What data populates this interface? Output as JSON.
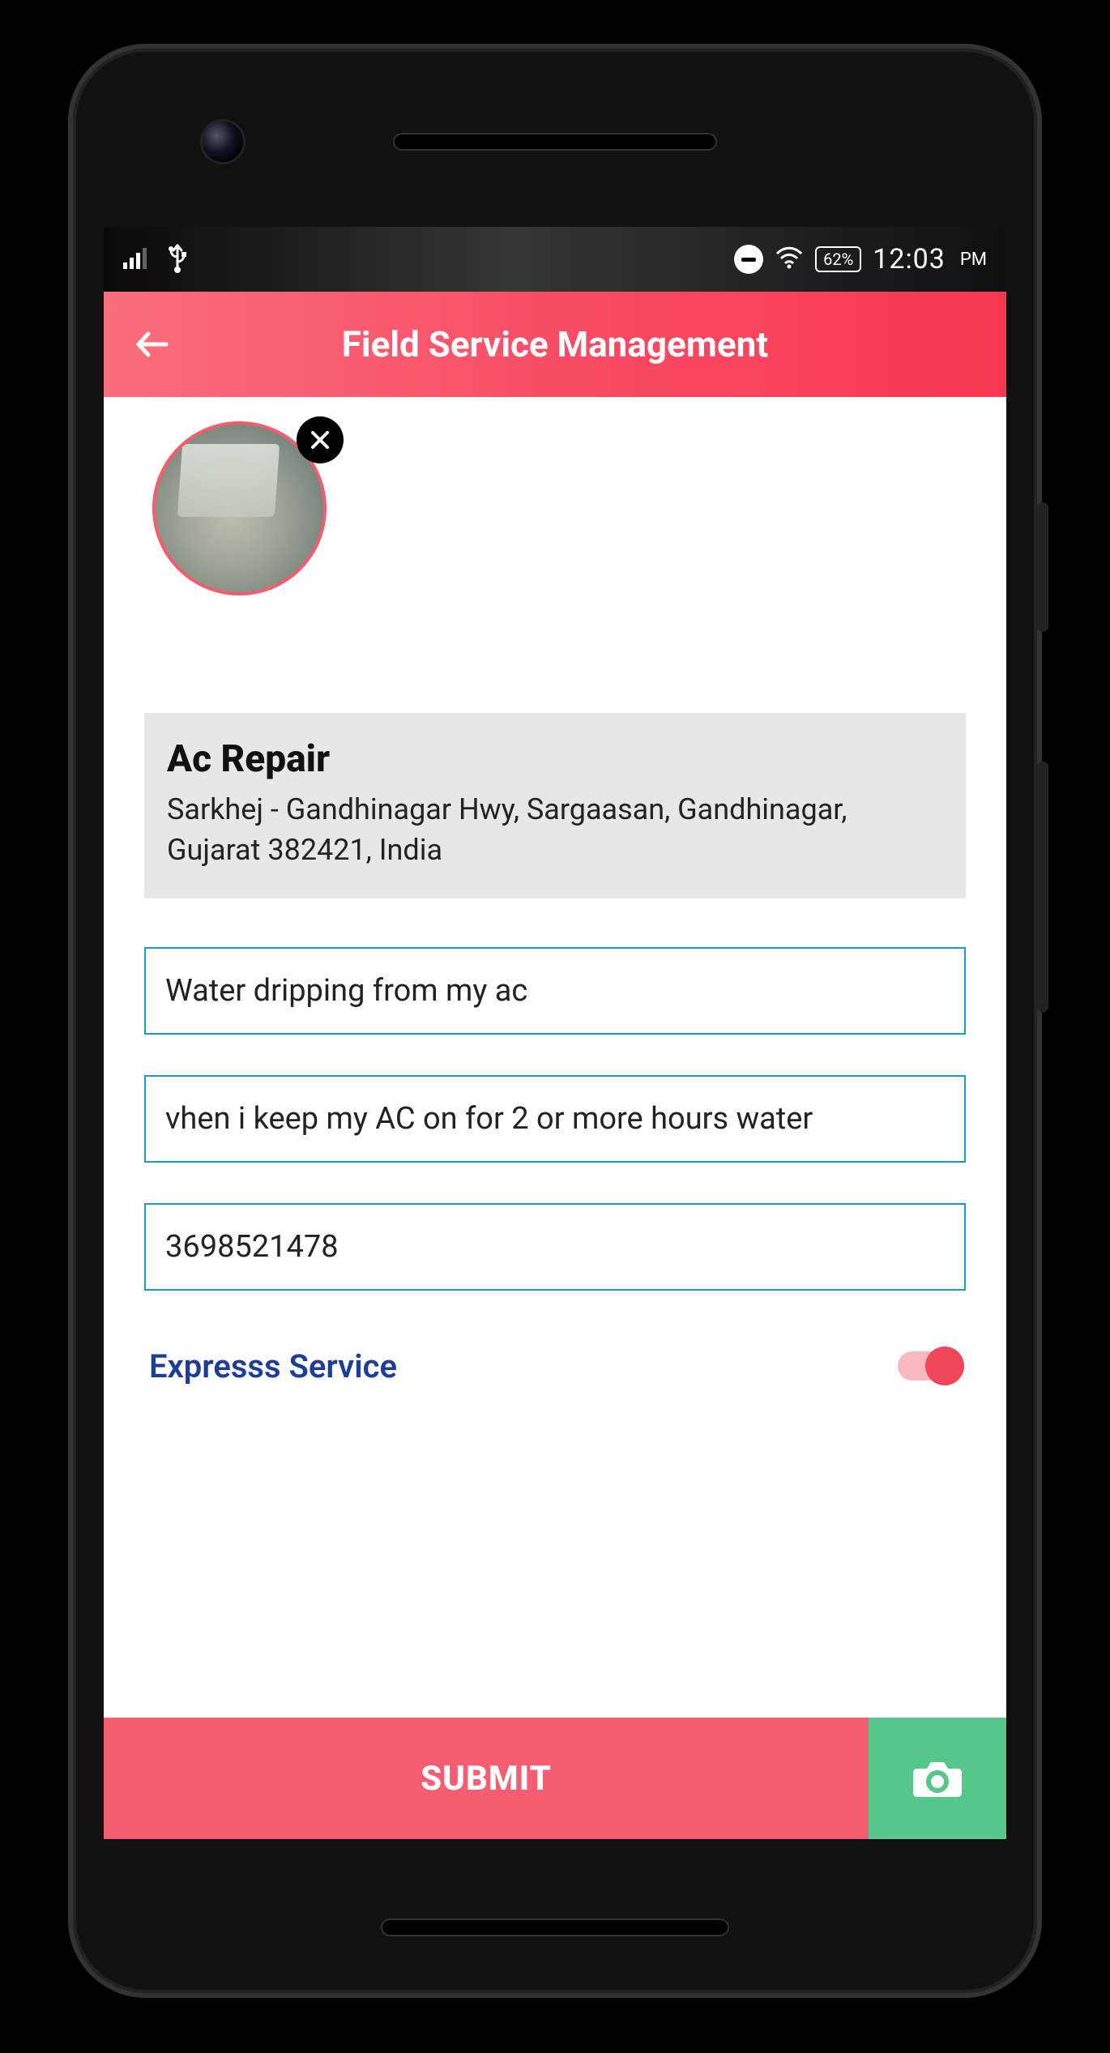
{
  "status_bar": {
    "battery_percent": "62%",
    "time": "12:03",
    "time_ampm": "PM"
  },
  "app_bar": {
    "title": "Field Service Management"
  },
  "service": {
    "title": "Ac Repair",
    "address": "Sarkhej - Gandhinagar Hwy, Sargaasan, Gandhinagar, Gujarat 382421, India"
  },
  "form": {
    "subject": "Water dripping from my ac",
    "description": "vhen i keep my AC on for 2 or more hours water",
    "phone": "3698521478",
    "express_label": "Expresss Service",
    "express_on": true
  },
  "actions": {
    "submit_label": "SUBMIT"
  },
  "icons": {
    "back": "arrow-back-icon",
    "remove_photo": "close-icon",
    "camera": "camera-icon",
    "signal": "signal-icon",
    "usb": "usb-icon",
    "dnd": "dnd-icon",
    "wifi": "wifi-icon",
    "battery": "battery-icon"
  },
  "colors": {
    "accent": "#f6384f",
    "field_border": "#1b9ac7",
    "camera_btn": "#57c68a",
    "express_text": "#1d3d9a"
  }
}
